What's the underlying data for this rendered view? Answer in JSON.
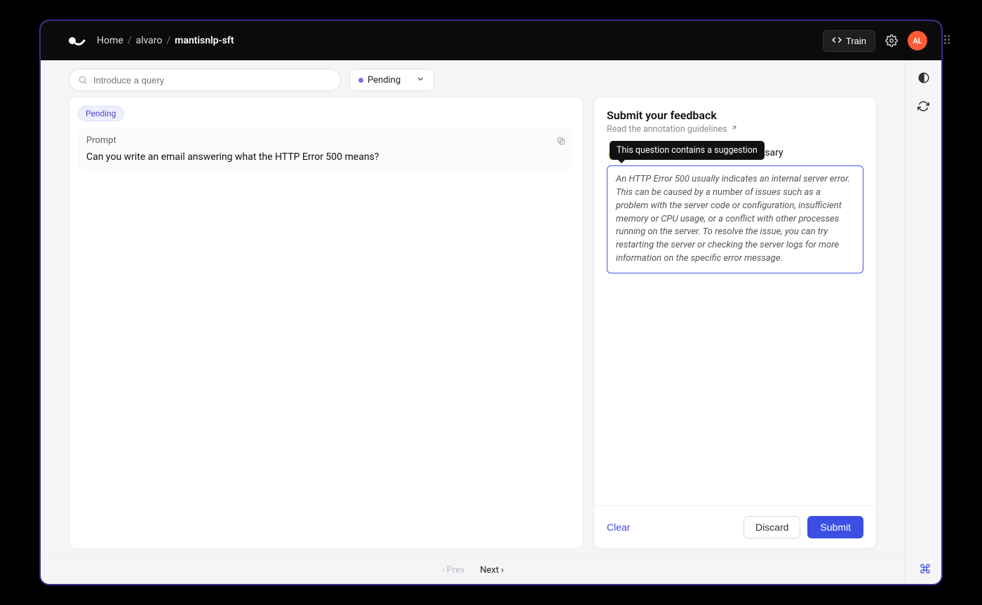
{
  "header": {
    "breadcrumb": {
      "home": "Home",
      "user": "alvaro",
      "project": "mantisnlp-sft"
    },
    "train_label": "Train",
    "avatar_initials": "AL"
  },
  "toolbar": {
    "search_placeholder": "Introduce a query",
    "filter_label": "Pending"
  },
  "prompt": {
    "status_badge": "Pending",
    "section_label": "Prompt",
    "text": "Can you write an email answering what the HTTP Error 500 means?"
  },
  "feedback": {
    "title": "Submit your feedback",
    "guidelines_label": "Read the annotation guidelines",
    "tooltip": "This question contains a suggestion",
    "sparkle": "✨",
    "instruction": "Add or edit the response if necessary",
    "response_text": "An HTTP Error 500 usually indicates an internal server error. This can be caused by a number of issues such as a problem with the server code or configuration, insufficient memory or CPU usage, or a conflict with other processes running on the server. To resolve the issue, you can try restarting the server or checking the server logs for more information on the specific error message.",
    "clear_label": "Clear",
    "discard_label": "Discard",
    "submit_label": "Submit"
  },
  "paginator": {
    "prev_label": "Prev",
    "next_label": "Next"
  }
}
